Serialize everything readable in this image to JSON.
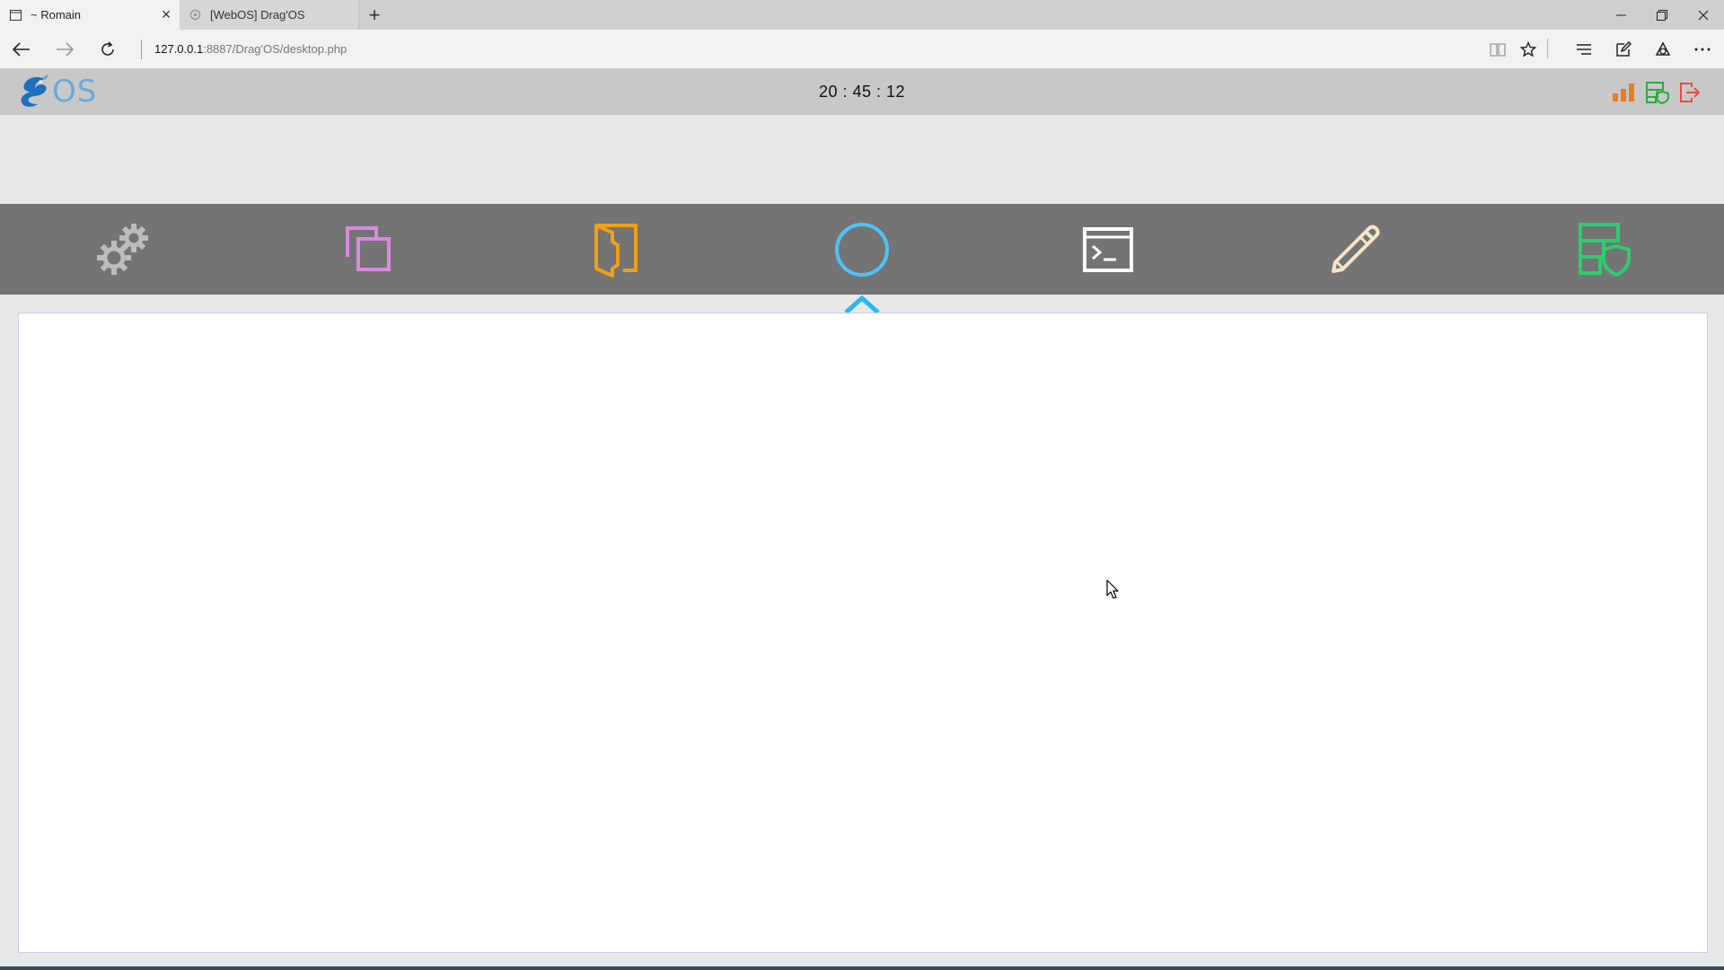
{
  "browser": {
    "tabs": [
      {
        "title": "~ Romain",
        "active": true
      },
      {
        "title": "[WebOS] Drag'OS",
        "active": false
      }
    ],
    "address": {
      "host": "127.0.0.1",
      "path": ":8887/Drag'OS/desktop.php"
    },
    "icons": {
      "back": "back-arrow-icon",
      "forward": "forward-arrow-icon",
      "refresh": "refresh-icon",
      "reading_view": "reading-view-icon",
      "favorite": "star-icon",
      "hub": "hub-icon",
      "notes": "web-note-icon",
      "share": "share-icon",
      "more": "more-icon"
    }
  },
  "app": {
    "logo_text": "OS",
    "clock": "20 : 45 : 12",
    "header_icons": [
      "bar-chart-icon",
      "database-shield-icon",
      "logout-icon"
    ],
    "dock": [
      {
        "name": "settings",
        "icon": "gears-icon",
        "color": "#b8b8b8"
      },
      {
        "name": "windows",
        "icon": "windows-icon",
        "color": "#d98be0"
      },
      {
        "name": "files",
        "icon": "folder-open-icon",
        "color": "#f0a019"
      },
      {
        "name": "home",
        "icon": "circle-icon",
        "color": "#4fc3f7",
        "selected": true
      },
      {
        "name": "terminal",
        "icon": "terminal-icon",
        "color": "#ffffff"
      },
      {
        "name": "editor",
        "icon": "pencil-icon",
        "color": "#f5e6c8"
      },
      {
        "name": "security",
        "icon": "database-shield-icon",
        "color": "#2ecc71"
      }
    ],
    "colors": {
      "header_bg": "#c8c8c8",
      "dock_bg": "#747474",
      "accent": "#29b6f6"
    }
  }
}
